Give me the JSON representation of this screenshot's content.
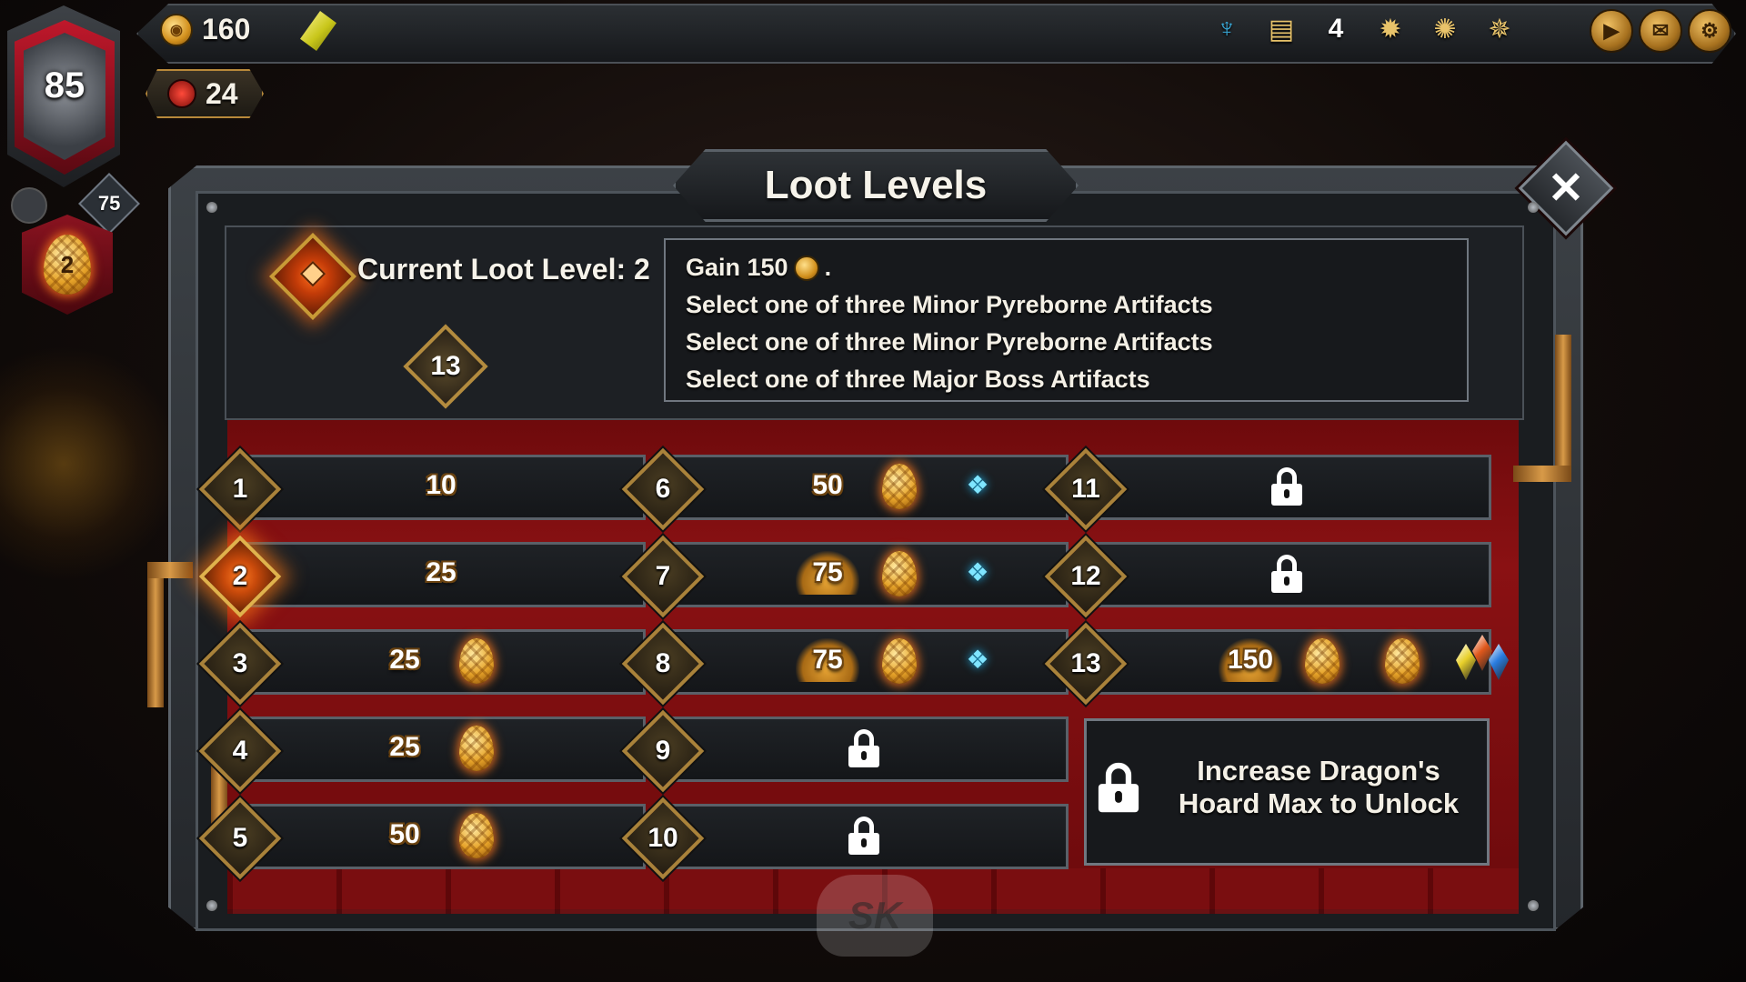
{
  "hud": {
    "gold": "160",
    "rage": "24",
    "bonus_count": "4",
    "hero_level": "85",
    "hero_sub": "75",
    "eggs": "2",
    "icons": [
      "trident-icon",
      "map-book-icon",
      "tower-icon",
      "sun-sigil-icon",
      "sun-crest-icon",
      "spider-sigil-icon"
    ],
    "buttons": [
      "play-icon",
      "scroll-icon",
      "gear-icon"
    ]
  },
  "modal": {
    "title": "Loot Levels",
    "current_label": "Current Loot Level: 2",
    "max_level": "13",
    "desc": {
      "gain_prefix": "Gain 150",
      "gain_suffix": ".",
      "line2": "Select one of three Minor Pyreborne Artifacts",
      "line3": "Select one of three Minor Pyreborne Artifacts",
      "line4": "Select one of three Major Boss Artifacts"
    },
    "unlock_text": "Increase Dragon's Hoard Max to Unlock",
    "watermark": "SK"
  },
  "levels": [
    {
      "level": "1",
      "gold": "10",
      "eggs": 0,
      "chest": false,
      "locked": false
    },
    {
      "level": "2",
      "gold": "25",
      "eggs": 0,
      "chest": false,
      "locked": false,
      "current": true
    },
    {
      "level": "3",
      "gold": "25",
      "eggs": 1,
      "chest": false,
      "locked": false
    },
    {
      "level": "4",
      "gold": "25",
      "eggs": 1,
      "chest": false,
      "locked": false
    },
    {
      "level": "5",
      "gold": "50",
      "eggs": 1,
      "chest": false,
      "locked": false
    },
    {
      "level": "6",
      "gold": "50",
      "eggs": 1,
      "chest": true,
      "locked": false
    },
    {
      "level": "7",
      "gold": "75",
      "eggs": 1,
      "chest": true,
      "locked": false
    },
    {
      "level": "8",
      "gold": "75",
      "eggs": 1,
      "chest": true,
      "locked": false
    },
    {
      "level": "9",
      "locked": true
    },
    {
      "level": "10",
      "locked": true
    },
    {
      "level": "11",
      "locked": true
    },
    {
      "level": "12",
      "locked": true
    },
    {
      "level": "13",
      "gold": "150",
      "eggs": 2,
      "gems": true,
      "locked": false
    }
  ],
  "colors": {
    "curtain": "#8a1113",
    "gold_border": "#a9823a",
    "current_glow": "#ff7b22",
    "panel": "#1a1d20"
  }
}
